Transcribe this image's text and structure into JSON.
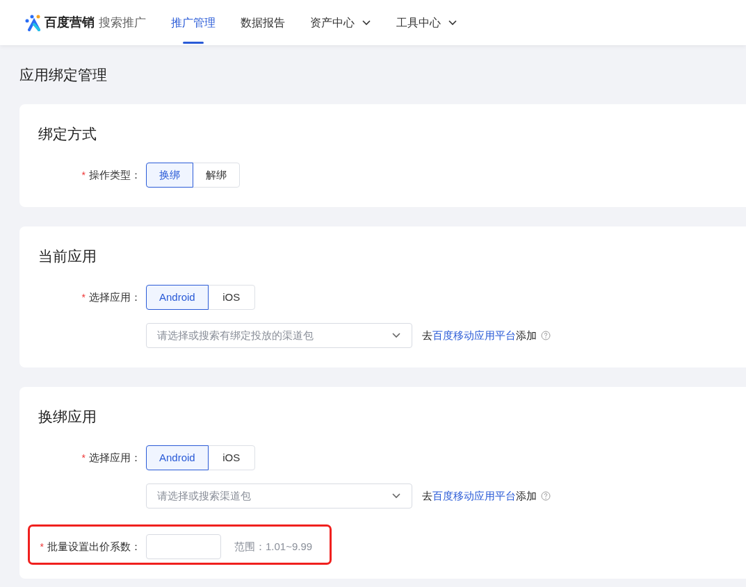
{
  "header": {
    "logo": {
      "brand": "百度营销",
      "product": "搜索推广"
    },
    "nav": [
      {
        "label": "推广管理",
        "selected": true,
        "dropdown": false
      },
      {
        "label": "数据报告",
        "selected": false,
        "dropdown": false
      },
      {
        "label": "资产中心",
        "selected": false,
        "dropdown": true
      },
      {
        "label": "工具中心",
        "selected": false,
        "dropdown": true
      }
    ]
  },
  "page_title": "应用绑定管理",
  "sections": [
    {
      "title": "绑定方式",
      "fields": [
        {
          "kind": "segmented",
          "required_mark": "*",
          "label": "操作类型：",
          "options": [
            {
              "label": "换绑",
              "selected": true
            },
            {
              "label": "解绑",
              "selected": false
            }
          ]
        }
      ]
    },
    {
      "title": "当前应用",
      "fields": [
        {
          "kind": "segmented",
          "required_mark": "*",
          "label": "选择应用：",
          "options": [
            {
              "label": "Android",
              "selected": true
            },
            {
              "label": "iOS",
              "selected": false
            }
          ]
        },
        {
          "kind": "select",
          "placeholder": "请选择或搜索有绑定投放的渠道包",
          "hint": {
            "prefix": "去",
            "link": "百度移动应用平台",
            "suffix": "添加"
          }
        }
      ]
    },
    {
      "title": "换绑应用",
      "fields": [
        {
          "kind": "segmented",
          "required_mark": "*",
          "label": "选择应用：",
          "options": [
            {
              "label": "Android",
              "selected": true
            },
            {
              "label": "iOS",
              "selected": false
            }
          ]
        },
        {
          "kind": "select",
          "placeholder": "请选择或搜索渠道包",
          "hint": {
            "prefix": "去",
            "link": "百度移动应用平台",
            "suffix": "添加"
          }
        },
        {
          "kind": "input",
          "required_mark": "*",
          "label": "批量设置出价系数：",
          "range": "范围：1.01~9.99",
          "highlighted": true
        }
      ]
    }
  ]
}
